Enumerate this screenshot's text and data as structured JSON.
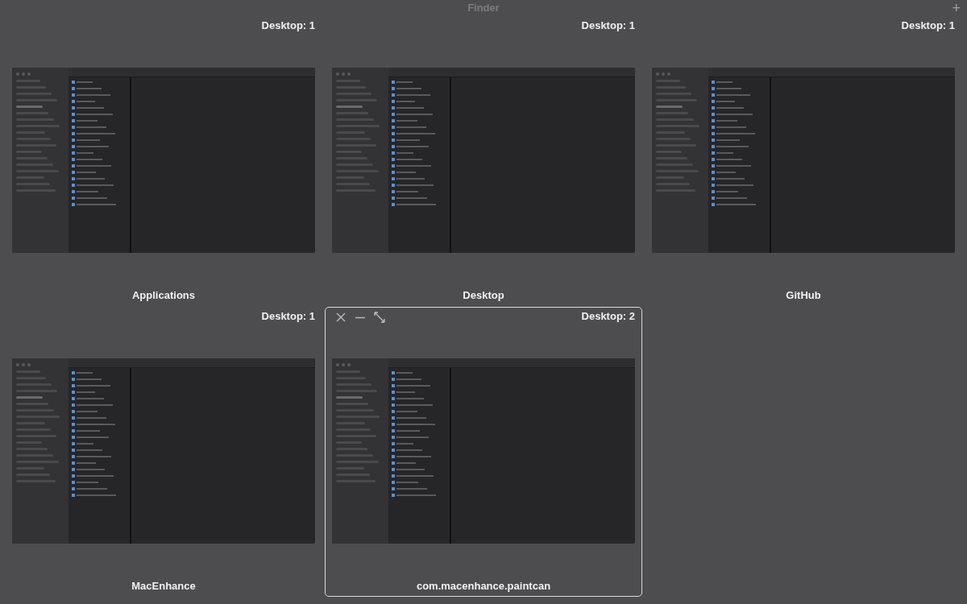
{
  "app_title": "Finder",
  "add_button": "+",
  "windows": [
    {
      "title": "Applications",
      "desktop": "Desktop: 1",
      "selected": false
    },
    {
      "title": "Desktop",
      "desktop": "Desktop: 1",
      "selected": false
    },
    {
      "title": "GitHub",
      "desktop": "Desktop: 1",
      "selected": false
    },
    {
      "title": "MacEnhance",
      "desktop": "Desktop: 1",
      "selected": false
    },
    {
      "title": "com.macenhance.paintcan",
      "desktop": "Desktop: 2",
      "selected": true
    }
  ]
}
